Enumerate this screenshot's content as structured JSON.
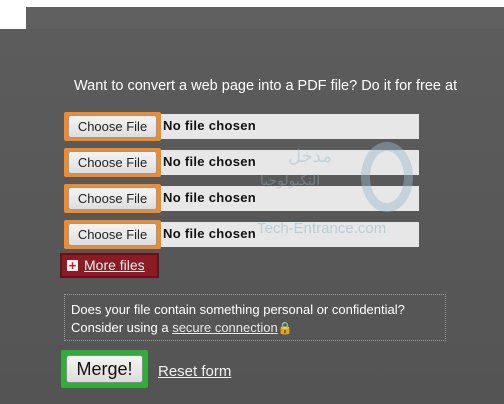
{
  "intro_text": "Want to convert a web page into a PDF file? Do it for free at",
  "file_rows": [
    {
      "button_label": "Choose File",
      "status": "No file chosen"
    },
    {
      "button_label": "Choose File",
      "status": "No file chosen"
    },
    {
      "button_label": "Choose File",
      "status": "No file chosen"
    },
    {
      "button_label": "Choose File",
      "status": "No file chosen"
    }
  ],
  "more_files": {
    "icon": "plus-icon",
    "label": "More files"
  },
  "notice": {
    "line1": "Does your file contain something personal or confidential?",
    "line2_prefix": "Consider using a",
    "link_label": "secure connection",
    "lock_icon": "lock-icon"
  },
  "actions": {
    "merge_label": "Merge!",
    "reset_label": "Reset form"
  },
  "highlights": {
    "file_buttons": "#f08a2a",
    "more_files": "#8b1b24",
    "merge": "#2fae3a"
  },
  "watermark": {
    "arabic_line1": "مدخل",
    "arabic_line2": "التكنولوجيا",
    "latin": "Tech-Entrance.com"
  }
}
